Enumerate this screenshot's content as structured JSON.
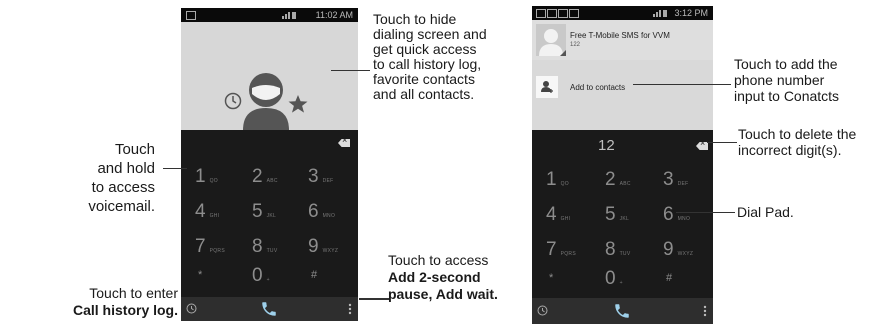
{
  "left_phone": {
    "status_time": "11:02 AM",
    "keys": [
      {
        "digit": "1",
        "letters": "QO"
      },
      {
        "digit": "2",
        "letters": "ABC"
      },
      {
        "digit": "3",
        "letters": "DEF"
      },
      {
        "digit": "4",
        "letters": "GHI"
      },
      {
        "digit": "5",
        "letters": "JKL"
      },
      {
        "digit": "6",
        "letters": "MNO"
      },
      {
        "digit": "7",
        "letters": "PQRS"
      },
      {
        "digit": "8",
        "letters": "TUV"
      },
      {
        "digit": "9",
        "letters": "WXYZ"
      },
      {
        "digit": "*",
        "letters": ""
      },
      {
        "digit": "0",
        "letters": "+"
      },
      {
        "digit": "#",
        "letters": ""
      }
    ]
  },
  "right_phone": {
    "status_time": "3:12 PM",
    "notification_title": "Free T-Mobile SMS for VVM",
    "notification_sub": "122",
    "add_contacts_label": "Add to contacts",
    "entered_number": "12",
    "keys": [
      {
        "digit": "1",
        "letters": "QO"
      },
      {
        "digit": "2",
        "letters": "ABC"
      },
      {
        "digit": "3",
        "letters": "DEF"
      },
      {
        "digit": "4",
        "letters": "GHI"
      },
      {
        "digit": "5",
        "letters": "JKL"
      },
      {
        "digit": "6",
        "letters": "MNO"
      },
      {
        "digit": "7",
        "letters": "PQRS"
      },
      {
        "digit": "8",
        "letters": "TUV"
      },
      {
        "digit": "9",
        "letters": "WXYZ"
      },
      {
        "digit": "*",
        "letters": ""
      },
      {
        "digit": "0",
        "letters": "+"
      },
      {
        "digit": "#",
        "letters": ""
      }
    ]
  },
  "callouts": {
    "hide_dialing": [
      "Touch to hide",
      "dialing screen and",
      "get quick access",
      "to call history log,",
      "favorite contacts",
      "and all contacts."
    ],
    "voicemail": [
      "Touch",
      "and hold",
      "to access",
      "voicemail."
    ],
    "call_history_1": "Touch to enter",
    "call_history_2": "Call history log.",
    "pause_1": "Touch to access",
    "pause_2": "Add 2-second",
    "pause_3": "pause, Add wait.",
    "add_contact": [
      "Touch to add the",
      "phone number",
      "input to Conatcts"
    ],
    "delete_digit": [
      "Touch to delete the",
      "incorrect digit(s)."
    ],
    "dial_pad": "Dial Pad."
  }
}
